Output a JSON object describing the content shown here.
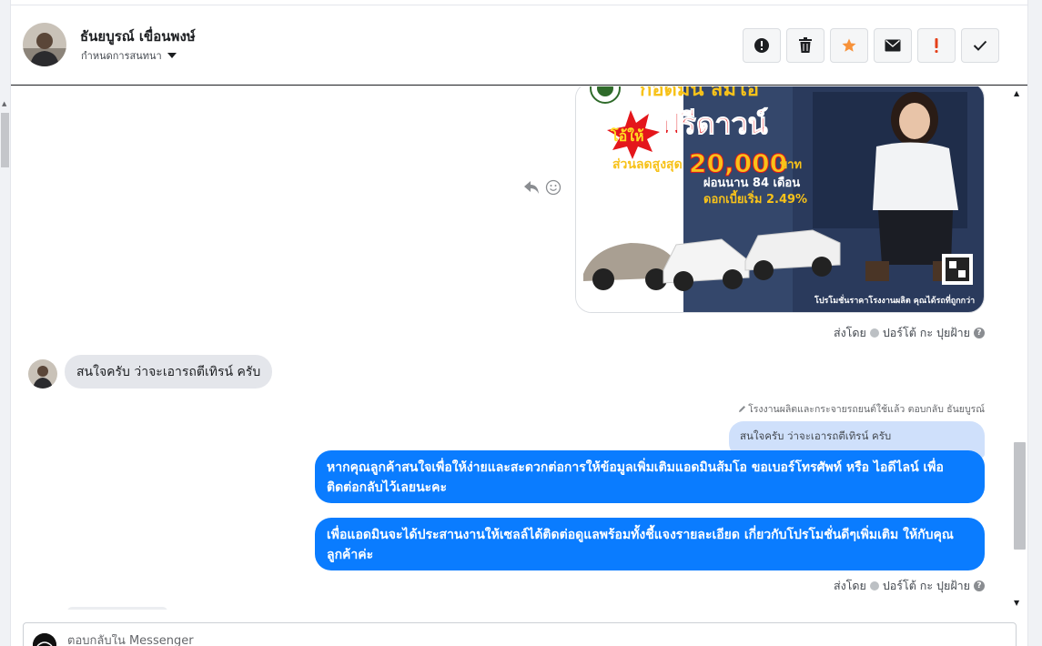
{
  "header": {
    "contact_name": "ธันยบูรณ์ เขื่อนพงษ์",
    "assign_label": "กำหนดการสนทนา"
  },
  "toolbar": {
    "buttons": [
      {
        "icon": "alert-circle-icon",
        "label": "spam"
      },
      {
        "icon": "trash-icon",
        "label": "delete"
      },
      {
        "icon": "star-icon",
        "label": "star",
        "color": "#f7923a"
      },
      {
        "icon": "envelope-icon",
        "label": "mark-unread"
      },
      {
        "icon": "exclamation-icon",
        "label": "follow-up",
        "color": "#e4401a"
      },
      {
        "icon": "check-icon",
        "label": "done"
      }
    ]
  },
  "ad_image": {
    "title_partial": "กอดมิน สมโอ",
    "badge": "โอ้ให้",
    "headline": "ฟรีดาวน์",
    "discount_label": "ส่วนลดสูงสุด",
    "discount_value": "20,000",
    "discount_unit": "บาท",
    "installment": "ผ่อนนาน 84 เดือน",
    "interest": "ดอกเบี้ยเริ่ม 2.49%",
    "footer": "โปรโมชั่นราคาโรงงานผลิต คุณได้รถที่ถูกกว่า"
  },
  "sent_by": {
    "prefix": "ส่งโดย",
    "agent": "ปอร์โต้ กะ ปุยฝ้าย",
    "help": "?"
  },
  "incoming_message": "สนใจครับ ว่าจะเอารถตีเทิรน์ ครับ",
  "reply_note": "โรงงานผลิตและกระจายรถยนต์ใช้แล้ว ตอบกลับ ธันยบูรณ์",
  "quoted_message": "สนใจครับ ว่าจะเอารถตีเทิรน์ ครับ",
  "outgoing_messages": [
    "หากคุณลูกค้าสนใจเพื่อให้ง่ายและสะดวกต่อการให้ข้อมูลเพิ่มเติมแอดมินส้มโอ ขอเบอร์โทรศัพท์ หรือ ไอดีไลน์ เพื่อติดต่อกลับไว้เลยนะคะ",
    "เพื่อแอดมินจะได้ประสานงานให้เซลล์ได้ติดต่อดูแลพร้อมทั้งชี้แจงรายละเอียด เกี่ยวกับโปรโมชั่นดีๆเพิ่มเติม ให้กับคุณลูกค้าค่ะ"
  ],
  "composer": {
    "placeholder": "ตอบกลับใน Messenger"
  },
  "colors": {
    "outgoing_bubble": "#0a7cff",
    "incoming_bubble": "#e4e6eb",
    "quoted_bubble": "#cfe0fb"
  }
}
